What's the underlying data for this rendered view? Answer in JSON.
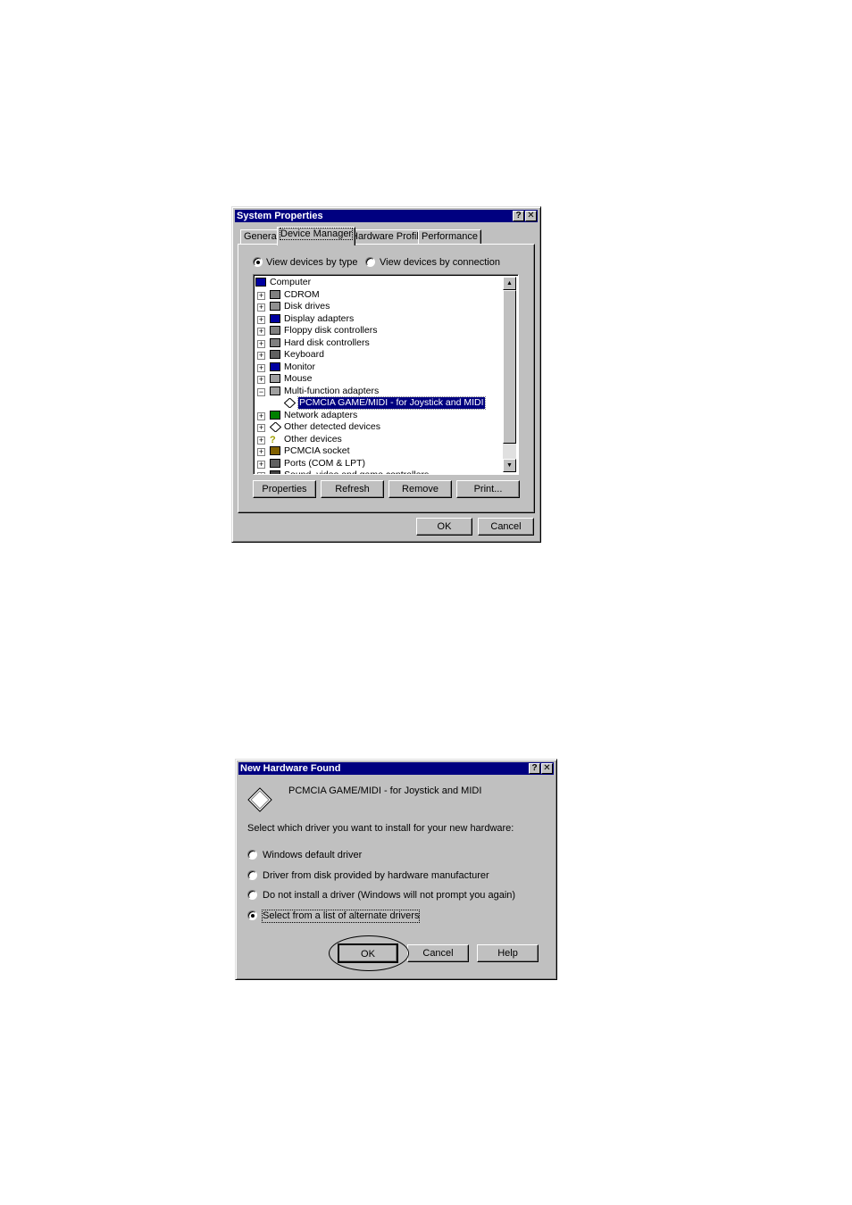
{
  "system_properties": {
    "title": "System Properties",
    "tabs": [
      "General",
      "Device Manager",
      "Hardware Profiles",
      "Performance"
    ],
    "active_tab": "Device Manager",
    "view_by_type": "View devices by type",
    "view_by_connection": "View devices by connection",
    "selected_view": "type",
    "tree": [
      {
        "label": "Computer",
        "level": 0,
        "icon": "computer-icon",
        "expander": "none"
      },
      {
        "label": "CDROM",
        "level": 1,
        "icon": "cdrom-icon",
        "expander": "plus"
      },
      {
        "label": "Disk drives",
        "level": 1,
        "icon": "disk-drive-icon",
        "expander": "plus"
      },
      {
        "label": "Display adapters",
        "level": 1,
        "icon": "display-adapter-icon",
        "expander": "plus"
      },
      {
        "label": "Floppy disk controllers",
        "level": 1,
        "icon": "floppy-controller-icon",
        "expander": "plus"
      },
      {
        "label": "Hard disk controllers",
        "level": 1,
        "icon": "hard-disk-controller-icon",
        "expander": "plus"
      },
      {
        "label": "Keyboard",
        "level": 1,
        "icon": "keyboard-icon",
        "expander": "plus"
      },
      {
        "label": "Monitor",
        "level": 1,
        "icon": "monitor-icon",
        "expander": "plus"
      },
      {
        "label": "Mouse",
        "level": 1,
        "icon": "mouse-icon",
        "expander": "plus"
      },
      {
        "label": "Multi-function adapters",
        "level": 1,
        "icon": "multifunction-icon",
        "expander": "minus"
      },
      {
        "label": "PCMCIA GAME/MIDI - for Joystick and MIDI",
        "level": 2,
        "icon": "diamond-icon",
        "expander": "none",
        "selected": true
      },
      {
        "label": "Network adapters",
        "level": 1,
        "icon": "network-adapter-icon",
        "expander": "plus"
      },
      {
        "label": "Other detected devices",
        "level": 1,
        "icon": "diamond-icon",
        "expander": "plus"
      },
      {
        "label": "Other devices",
        "level": 1,
        "icon": "question-icon",
        "expander": "plus"
      },
      {
        "label": "PCMCIA socket",
        "level": 1,
        "icon": "pcmcia-icon",
        "expander": "plus"
      },
      {
        "label": "Ports (COM & LPT)",
        "level": 1,
        "icon": "port-icon",
        "expander": "plus"
      },
      {
        "label": "Sound, video and game controllers",
        "level": 1,
        "icon": "sound-icon",
        "expander": "plus"
      }
    ],
    "buttons": {
      "properties": "Properties",
      "refresh": "Refresh",
      "remove": "Remove",
      "print": "Print...",
      "ok": "OK",
      "cancel": "Cancel"
    }
  },
  "new_hardware": {
    "title": "New Hardware Found",
    "device_name": "PCMCIA GAME/MIDI - for Joystick and MIDI",
    "prompt": "Select which driver you want to install for your new hardware:",
    "options": [
      "Windows default driver",
      "Driver from disk provided by hardware manufacturer",
      "Do not install a driver (Windows will not prompt you again)",
      "Select from a list of alternate drivers"
    ],
    "selected_option": 3,
    "buttons": {
      "ok": "OK",
      "cancel": "Cancel",
      "help": "Help"
    }
  }
}
